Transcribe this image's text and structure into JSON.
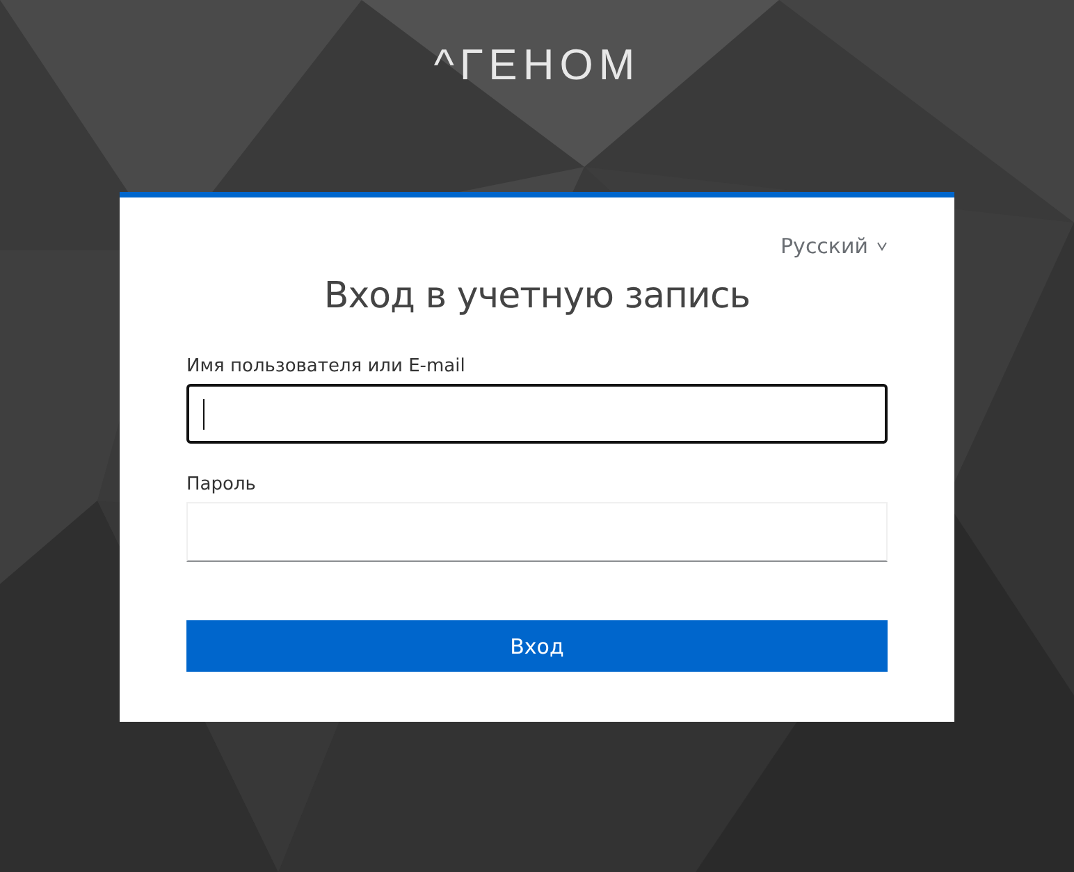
{
  "logo": "^ГЕНОМ",
  "language": {
    "label": "Русский"
  },
  "title": "Вход в учетную запись",
  "fields": [
    {
      "label": "Имя пользователя или E-mail",
      "focused": true
    },
    {
      "label": "Пароль",
      "focused": false
    }
  ],
  "submit_button": "Вход"
}
